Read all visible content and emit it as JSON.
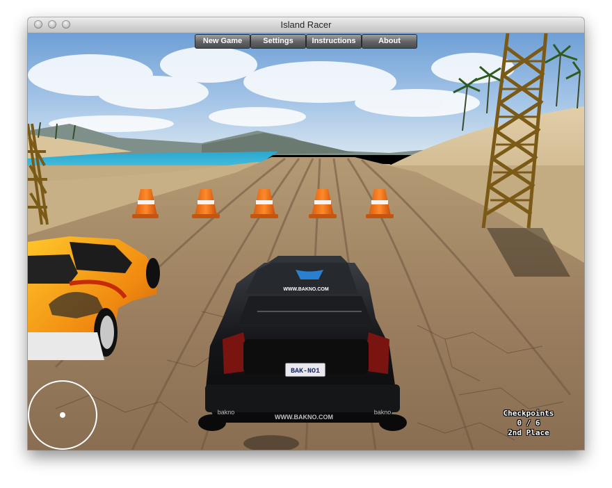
{
  "window": {
    "title": "Island Racer"
  },
  "menu": {
    "buttons": [
      "New Game",
      "Settings",
      "Instructions",
      "About"
    ]
  },
  "hud": {
    "checkpoints_label": "Checkpoints",
    "checkpoints_progress": "0 / 6",
    "position": "2nd Place"
  },
  "player_car": {
    "plate": "BAK-NO1",
    "site": "WWW.BAKNO.COM",
    "brand": "bakno"
  },
  "colors": {
    "sky": "#8eb6e0",
    "sand": "#cdb68a",
    "track": "#a08462",
    "sea": "#3ab5d8",
    "cone": "#f07a1a"
  }
}
